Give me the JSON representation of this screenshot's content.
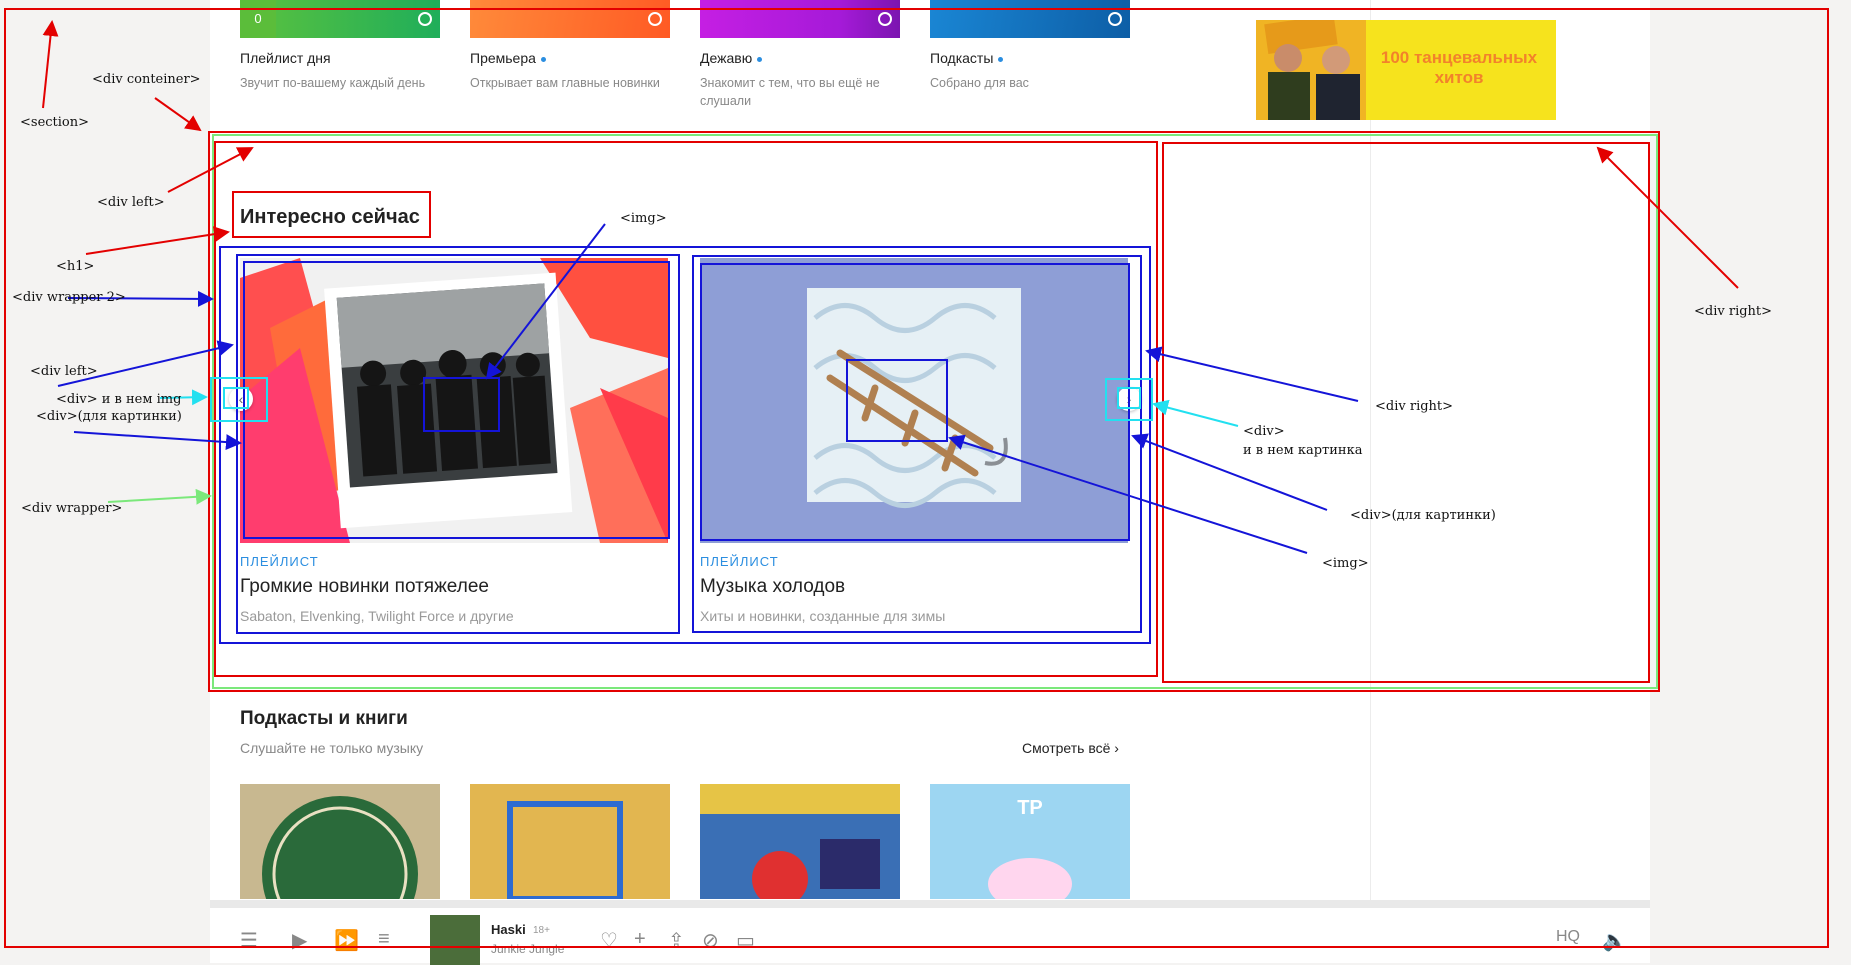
{
  "daily": [
    {
      "title": "Плейлист дня",
      "sub": "Звучит по-вашему каждый день",
      "counter": "0",
      "dot": false,
      "color": "#5cc23e"
    },
    {
      "title": "Премьера",
      "sub": "Открывает вам главные новинки",
      "dot": true,
      "color": "#ff7b3b"
    },
    {
      "title": "Дежавю",
      "sub": "Знакомит с тем, что вы ещё не слушали",
      "dot": true,
      "color": "#c51fe3"
    },
    {
      "title": "Подкасты",
      "sub": "Собрано для вас",
      "dot": true,
      "color": "#1677c9"
    }
  ],
  "banner": {
    "text": "100 танцевальных хитов"
  },
  "section": {
    "title": "Интересно сейчас"
  },
  "items": [
    {
      "kind": "ПЛЕЙЛИСТ",
      "title": "Громкие новинки потяжелее",
      "sub": "Sabaton, Elvenking, Twilight Force и другие"
    },
    {
      "kind": "ПЛЕЙЛИСТ",
      "title": "Музыка холодов",
      "sub": "Хиты и новинки, созданные для зимы"
    }
  ],
  "podcasts": {
    "title": "Подкасты и книги",
    "sub": "Слушайте не только музыку",
    "see_all": "Смотреть всё"
  },
  "player": {
    "title": "Haski",
    "age": "18+",
    "artist": "Junkie Jungle",
    "quality": "HQ"
  },
  "annotations": {
    "section": "<section>",
    "container": "<div conteiner>",
    "left": "<div left>",
    "h1": "<h1>",
    "wrapper2": "<div wrapper 2>",
    "inner_left": "<div left>",
    "div_img_left_1": "<div> и в нем img",
    "div_img_left_2": "<div>(для картинки)",
    "wrapper": "<div wrapper>",
    "img_top": "<img>",
    "right": "<div right>",
    "inner_right": "<div right>",
    "div_right_1": "<div>",
    "div_right_2": "и в нем картинка",
    "div_for_img": "<div>(для картинки)",
    "img_bottom": "<img>"
  }
}
